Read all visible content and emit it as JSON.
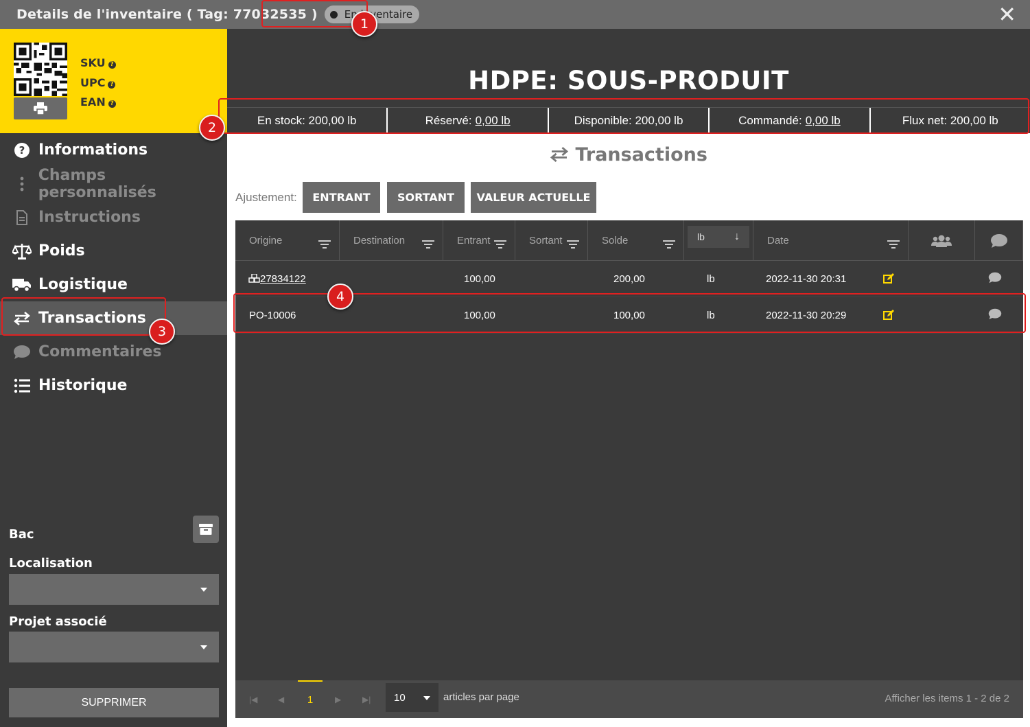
{
  "window": {
    "title": "Details de l'inventaire ( Tag: 77032535 )",
    "status": "En inventaire",
    "close_icon": "close-icon"
  },
  "card": {
    "sku_label": "SKU",
    "upc_label": "UPC",
    "ean_label": "EAN",
    "accent_color": "#ffd800"
  },
  "nav": {
    "items": [
      {
        "label": "Informations",
        "icon": "question-circle-icon",
        "state": "normal"
      },
      {
        "label": "Champs personnalisés",
        "icon": "vertical-ellipsis-icon",
        "state": "dim"
      },
      {
        "label": "Instructions",
        "icon": "document-icon",
        "state": "dim"
      },
      {
        "label": "Poids",
        "icon": "balance-scale-icon",
        "state": "normal"
      },
      {
        "label": "Logistique",
        "icon": "truck-icon",
        "state": "normal"
      },
      {
        "label": "Transactions",
        "icon": "exchange-arrows-icon",
        "state": "active"
      },
      {
        "label": "Commentaires",
        "icon": "speech-bubble-icon",
        "state": "dim"
      },
      {
        "label": "Historique",
        "icon": "list-icon",
        "state": "normal"
      }
    ]
  },
  "side": {
    "bin_label": "Bac",
    "location_label": "Localisation",
    "project_label": "Projet associé",
    "delete_label": "SUPPRIMER"
  },
  "product": {
    "title": "HDPE: SOUS-PRODUIT"
  },
  "stats": {
    "in_stock_label": "En stock:",
    "in_stock_value": "200,00 lb",
    "reserved_label": "Réservé:",
    "reserved_value": "0,00 lb",
    "available_label": "Disponible:",
    "available_value": "200,00 lb",
    "ordered_label": "Commandé:",
    "ordered_value": "0,00 lb",
    "net_flow_label": "Flux net:",
    "net_flow_value": "200,00 lb"
  },
  "transactions": {
    "section_title": "Transactions",
    "adjust_label": "Ajustement:",
    "btn_in": "ENTRANT",
    "btn_out": "SORTANT",
    "btn_current": "VALEUR ACTUELLE",
    "columns": {
      "origin": "Origine",
      "destination": "Destination",
      "in": "Entrant",
      "out": "Sortant",
      "balance": "Solde",
      "unit": "lb",
      "date": "Date"
    },
    "rows": [
      {
        "origin": "27834122",
        "destination": "",
        "in": "100,00",
        "out": "",
        "balance": "200,00",
        "unit": "lb",
        "date": "2022-11-30 20:31"
      },
      {
        "origin": "PO-10006",
        "destination": "",
        "in": "100,00",
        "out": "",
        "balance": "100,00",
        "unit": "lb",
        "date": "2022-11-30 20:29"
      }
    ],
    "pager": {
      "current_page": "1",
      "per_page": "10",
      "per_page_label": "articles par page",
      "items_info": "Afficher les items 1 - 2 de 2"
    }
  },
  "annotations": [
    "1",
    "2",
    "3",
    "4"
  ]
}
